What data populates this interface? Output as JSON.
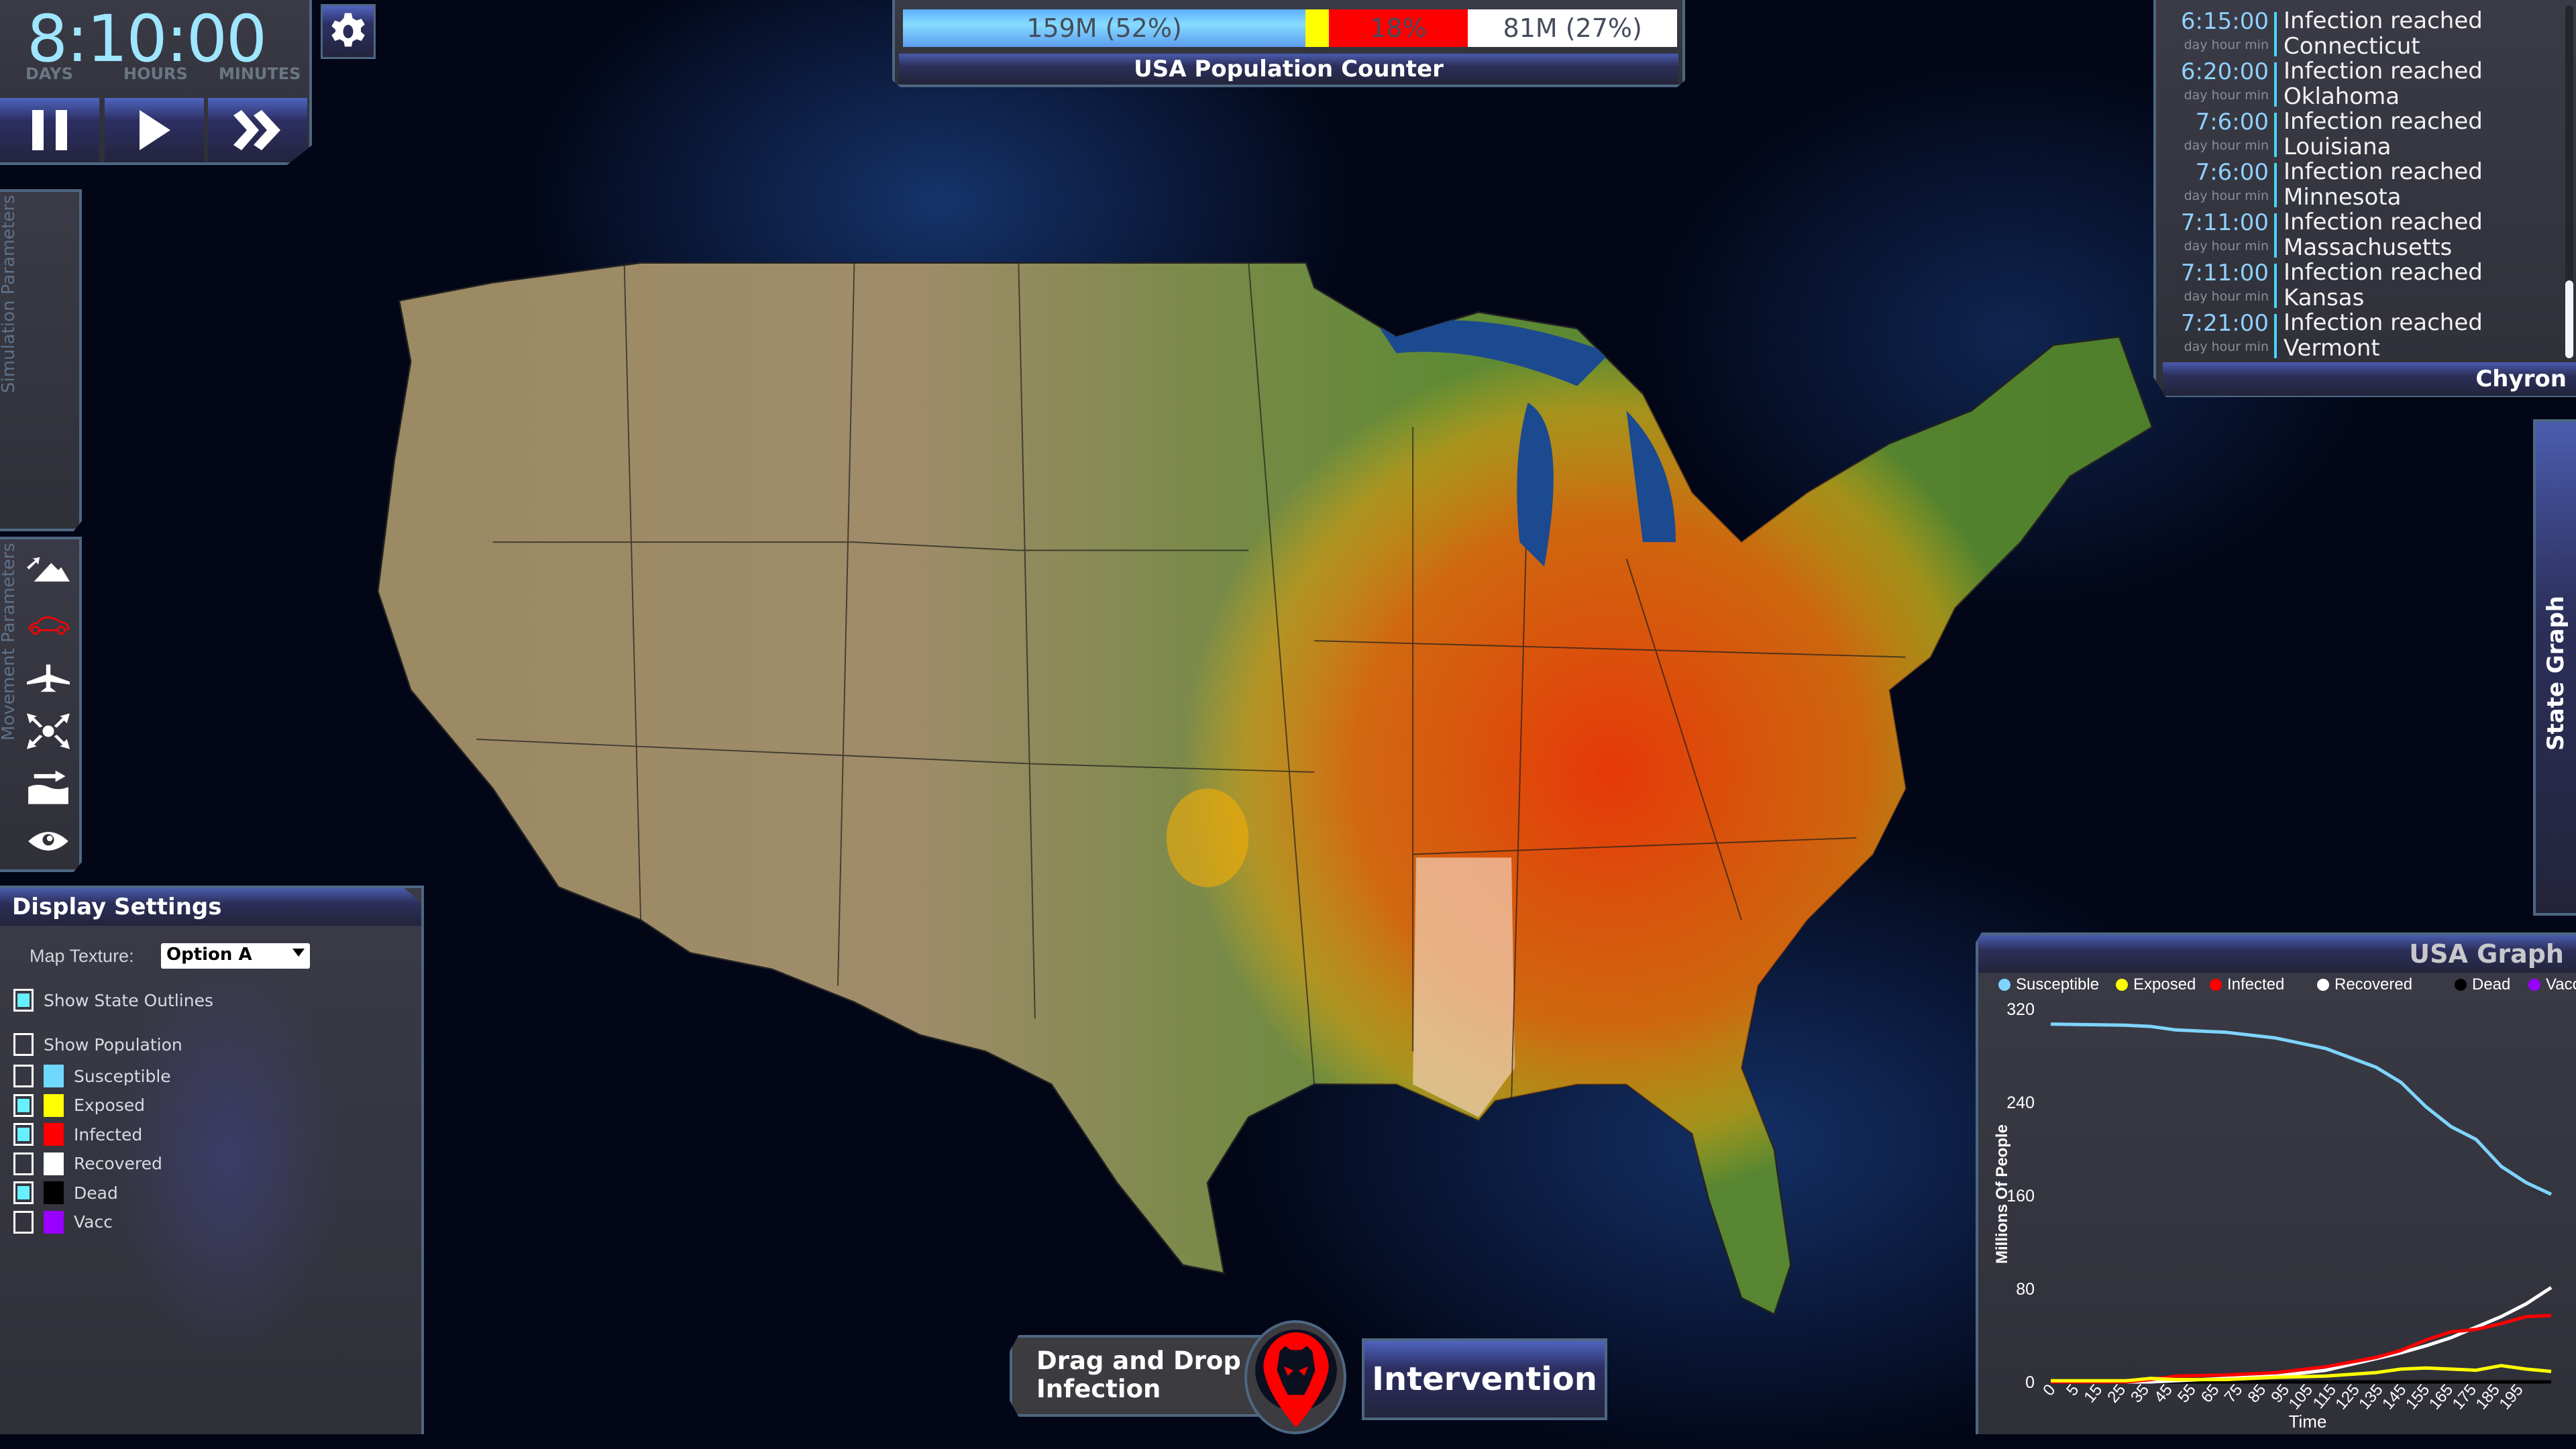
{
  "clock": {
    "time": "8:10:00",
    "labels": {
      "days": "DAYS",
      "hours": "HOURS",
      "minutes": "MINUTES"
    },
    "buttons": {
      "pause": "pause-icon",
      "play": "play-icon",
      "fast_forward": "fast-forward-icon"
    },
    "settings_icon": "gear-icon"
  },
  "side_panels": {
    "simulation": "Simulation Parameters",
    "movement": "Movement Parameters",
    "movement_icons": [
      "terrain-icon",
      "car-icon",
      "airplane-icon",
      "spread-icon",
      "water-icon",
      "eye-icon"
    ],
    "active_icon": "car-icon"
  },
  "display_settings": {
    "title": "Display Settings",
    "map_texture_label": "Map Texture:",
    "map_texture_value": "Option A",
    "show_state_outlines": {
      "label": "Show State Outlines",
      "checked": true
    },
    "show_population": {
      "label": "Show Population",
      "checked": false
    },
    "layers": [
      {
        "label": "Susceptible",
        "color": "#6fd8ff",
        "checked": false
      },
      {
        "label": "Exposed",
        "color": "#ffff00",
        "checked": true
      },
      {
        "label": "Infected",
        "color": "#ff0000",
        "checked": true
      },
      {
        "label": "Recovered",
        "color": "#ffffff",
        "checked": false
      },
      {
        "label": "Dead",
        "color": "#000000",
        "checked": true
      },
      {
        "label": "Vacc",
        "color": "#9900ff",
        "checked": false
      }
    ]
  },
  "population_counter": {
    "title": "USA Population Counter",
    "segments": [
      {
        "label": "159M (52%)",
        "percent": 52,
        "color": "#7fd6ff"
      },
      {
        "label": "",
        "percent": 3,
        "color": "#ffff00"
      },
      {
        "label": "18%",
        "percent": 18,
        "color": "#ff0000"
      },
      {
        "label": "81M (27%)",
        "percent": 27,
        "color": "#ffffff"
      }
    ]
  },
  "chyron": {
    "title": "Chyron",
    "unit_label": "day hour min",
    "events": [
      {
        "time": "6:15:00",
        "message": "Infection reached Connecticut"
      },
      {
        "time": "6:20:00",
        "message": "Infection reached Oklahoma"
      },
      {
        "time": "7:6:00",
        "message": "Infection reached Louisiana"
      },
      {
        "time": "7:6:00",
        "message": "Infection reached Minnesota"
      },
      {
        "time": "7:11:00",
        "message": "Infection reached Massachusetts"
      },
      {
        "time": "7:11:00",
        "message": "Infection reached Kansas"
      },
      {
        "time": "7:21:00",
        "message": "Infection reached Vermont"
      }
    ]
  },
  "state_graph_tab": "State Graph",
  "actions": {
    "drag_drop": "Drag and Drop Infection",
    "drag_icon": "skull-pin-icon",
    "intervention": "Intervention"
  },
  "chart_data": {
    "type": "line",
    "title": "USA Graph",
    "xlabel": "Time",
    "ylabel": "Millions Of People",
    "xlim": [
      0,
      200
    ],
    "ylim": [
      0,
      320
    ],
    "x_ticks": [
      0,
      5,
      15,
      25,
      35,
      45,
      55,
      65,
      75,
      85,
      95,
      105,
      115,
      125,
      135,
      145,
      155,
      165,
      175,
      185,
      195
    ],
    "y_ticks": [
      0,
      80,
      160,
      240,
      320
    ],
    "legend": "top",
    "grid": false,
    "x": [
      0,
      30,
      40,
      50,
      70,
      90,
      110,
      130,
      140,
      150,
      160,
      170,
      180,
      190,
      200
    ],
    "series": [
      {
        "name": "Susceptible",
        "color": "#7fd4ff",
        "values": [
          307,
          306,
          305,
          302,
          300,
          295,
          286,
          270,
          257,
          236,
          219,
          208,
          185,
          171,
          161
        ]
      },
      {
        "name": "Exposed",
        "color": "#ffff00",
        "values": [
          1,
          1,
          3,
          2,
          2,
          4,
          5,
          8,
          11,
          12,
          11,
          10,
          14,
          11,
          9
        ]
      },
      {
        "name": "Infected",
        "color": "#ff0000",
        "values": [
          0,
          0,
          2,
          5,
          6,
          8,
          13,
          21,
          27,
          36,
          43,
          45,
          50,
          56,
          57
        ]
      },
      {
        "name": "Recovered",
        "color": "#ffffff",
        "values": [
          0,
          0,
          0,
          1,
          3,
          5,
          10,
          20,
          25,
          31,
          38,
          47,
          56,
          67,
          81
        ]
      },
      {
        "name": "Dead",
        "color": "#000000",
        "values": [
          0,
          0,
          0,
          0,
          0,
          0,
          0,
          0,
          0,
          0,
          0,
          0,
          0,
          0,
          0
        ]
      },
      {
        "name": "Vacc",
        "color": "#9900ff",
        "values": [
          0,
          0,
          0,
          0,
          0,
          0,
          0,
          0,
          0,
          0,
          0,
          0,
          0,
          0,
          0
        ]
      }
    ]
  }
}
